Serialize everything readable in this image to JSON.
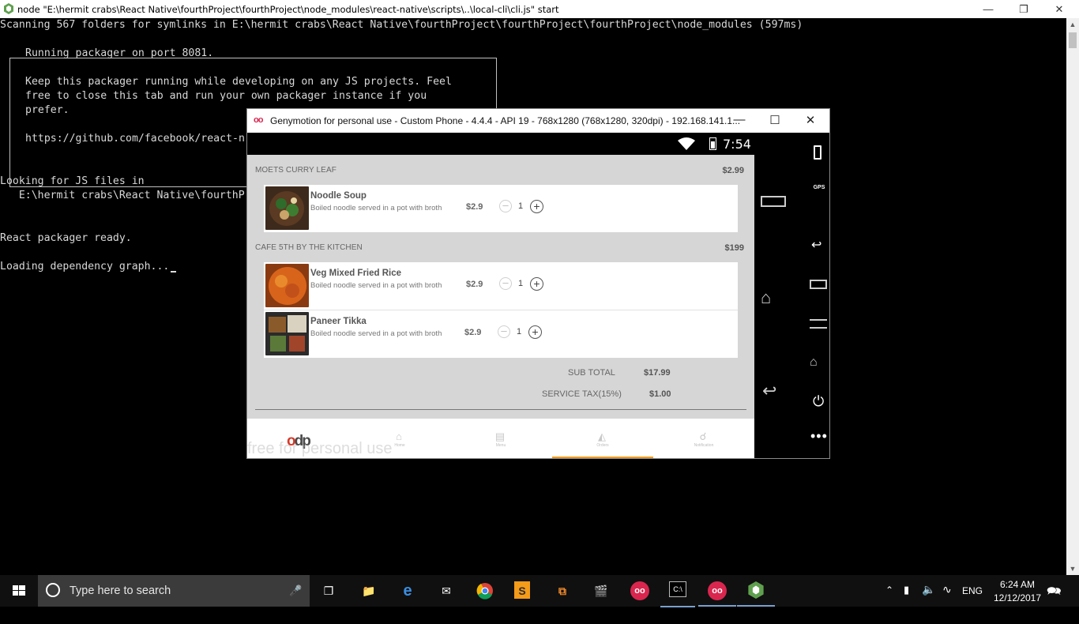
{
  "console_window": {
    "title": "node  \"E:\\hermit crabs\\React Native\\fourthProject\\fourthProject\\node_modules\\react-native\\scripts\\..\\local-cli\\cli.js\" start",
    "lines": {
      "scanning": "Scanning 567 folders for symlinks in E:\\hermit crabs\\React Native\\fourthProject\\fourthProject\\fourthProject\\node_modules (597ms)",
      "box_1": "Running packager on port 8081.",
      "box_2": "Keep this packager running while developing on any JS projects. Feel",
      "box_3": "free to close this tab and run your own packager instance if you",
      "box_4": "prefer.",
      "box_5": "https://github.com/facebook/react-n",
      "looking": "Looking for JS files in",
      "path": "   E:\\hermit crabs\\React Native\\fourthP",
      "ready": "React packager ready.",
      "loading": "Loading dependency graph..."
    }
  },
  "genymotion": {
    "title": "Genymotion for personal use - Custom Phone - 4.4.4 - API 19 - 768x1280 (768x1280, 320dpi) - 192.168.141.1...",
    "logo_text": "oo",
    "status_time": "7:54",
    "watermark": "free for personal use",
    "sidepanel": {
      "gps_label": "GPS"
    }
  },
  "app": {
    "sections": [
      {
        "name": "MOETS CURRY LEAF",
        "total": "$2.99",
        "items": [
          {
            "name": "Noodle Soup",
            "desc": "Boiled noodle served in a pot with broth",
            "price": "$2.9",
            "qty": "1"
          }
        ]
      },
      {
        "name": "CAFE 5TH BY THE KITCHEN",
        "total": "$199",
        "items": [
          {
            "name": "Veg Mixed Fried Rice",
            "desc": "Boiled noodle served in a pot with broth",
            "price": "$2.9",
            "qty": "1"
          },
          {
            "name": "Paneer Tikka",
            "desc": "Boiled noodle served in a pot with broth",
            "price": "$2.9",
            "qty": "1"
          }
        ]
      }
    ],
    "summary": {
      "subtotal_label": "SUB TOTAL",
      "subtotal_value": "$17.99",
      "tax_label": "SERVICE TAX(15%)",
      "tax_value": "$1.00"
    },
    "tabs": [
      {
        "label": "Home",
        "icon": "home-icon"
      },
      {
        "label": "Menu",
        "icon": "menu-book-icon"
      },
      {
        "label": "Orders",
        "icon": "cloche-icon",
        "active": true
      },
      {
        "label": "Notification",
        "icon": "bell-icon"
      }
    ],
    "logo": {
      "text_a": "o",
      "text_b": "dp"
    },
    "accent_color": "#f39a1e"
  },
  "taskbar": {
    "search_placeholder": "Type here to search",
    "language": "ENG",
    "time": "6:24 AM",
    "date": "12/12/2017"
  }
}
